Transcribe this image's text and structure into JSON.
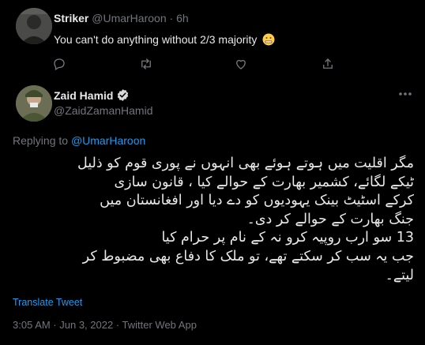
{
  "reply_tweet": {
    "name": "Striker",
    "handle": "@UmarHaroon",
    "separator": "·",
    "time": "6h",
    "text": "You can't do anything without 2/3 majority",
    "emoji_icon": "grimacing-face-emoji-icon"
  },
  "main_tweet": {
    "name": "Zaid Hamid",
    "handle": "@ZaidZamanHamid",
    "verified_icon": "verified-badge-icon",
    "replying_prefix": "Replying to",
    "replying_handle": "@UmarHaroon",
    "text_lines": [
      "مگر اقلیت میں ہوتے ہوئے بھی انہوں نے پوری قوم کو ذلیل",
      "ٹیکے لگائے، کشمیر بھارت کے حوالے کیا ، قانون سازی",
      "کرکے اسٹیٹ بینک یہودیوں کو دے دیا اور افغانستان میں",
      "جنگ  بھارت کے حوالے کر دی۔",
      "13 سو ارب روپیہ کرو نہ کے نام پر حرام کیا",
      "جب یہ سب کر سکتے تھے، تو ملک کا دفاع بھی مضبوط کر",
      "لیتے۔"
    ],
    "translate_label": "Translate Tweet",
    "timestamp": "3:05 AM · Jun 3, 2022 · Twitter Web App"
  },
  "colors": {
    "background": "#000000",
    "text": "#e7e9ea",
    "muted": "#71767b",
    "accent": "#1d9bf0",
    "divider": "#2f3336"
  }
}
